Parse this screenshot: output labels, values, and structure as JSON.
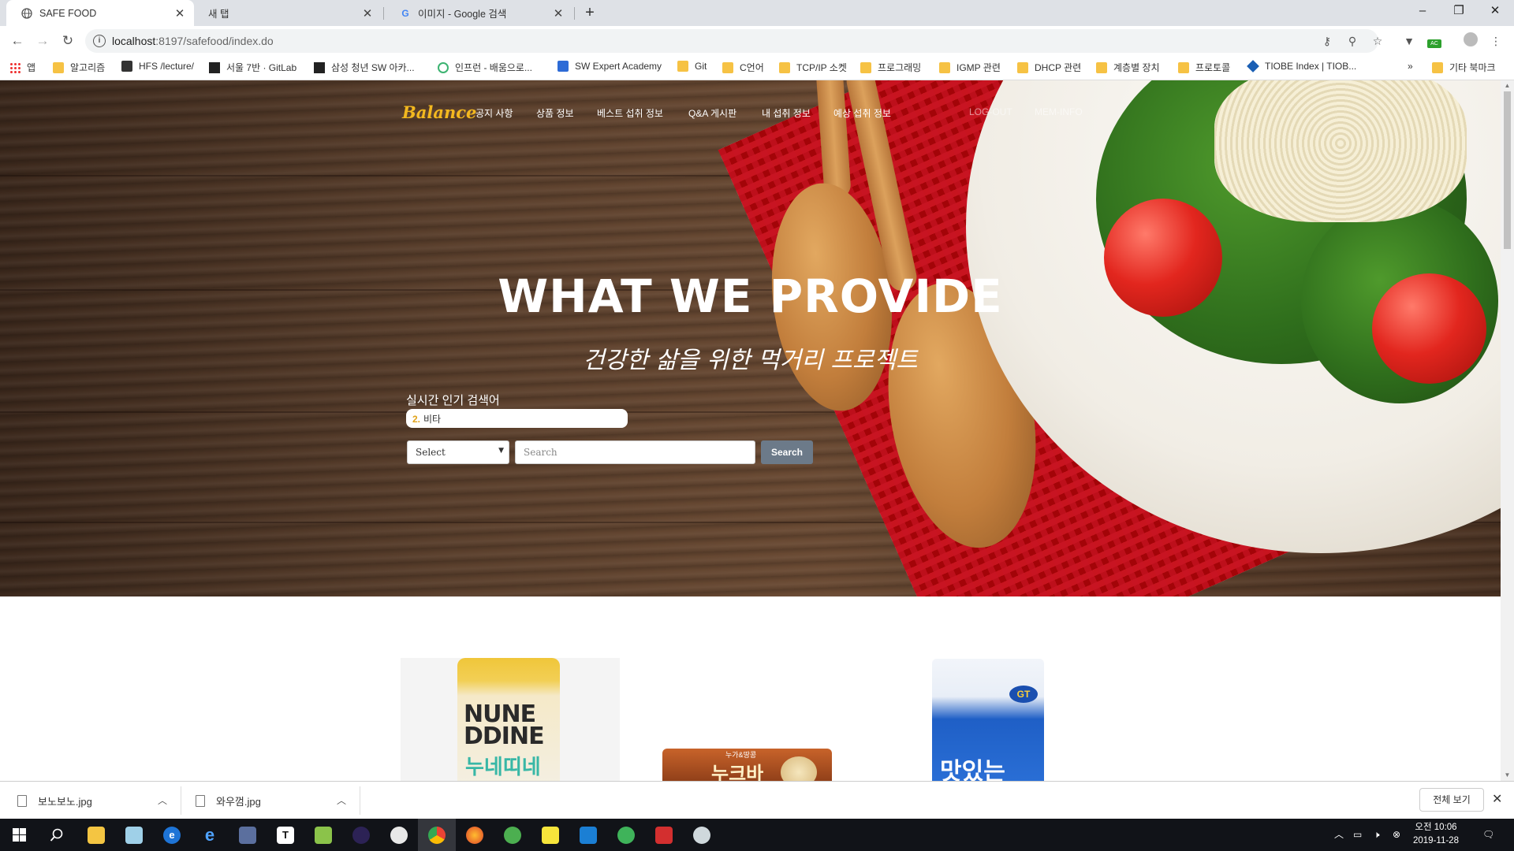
{
  "browser": {
    "tabs": [
      {
        "title": "SAFE FOOD",
        "favicon": "globe-icon",
        "active": true
      },
      {
        "title": "새 탭",
        "favicon": "",
        "active": false
      },
      {
        "title": "이미지 - Google 검색",
        "favicon": "google-icon",
        "active": false
      }
    ],
    "url_host": "localhost",
    "url_rest": ":8197/safefood/index.do",
    "bookmarks": [
      {
        "label": "앱",
        "icon": "apps-grid-icon"
      },
      {
        "label": "알고리즘",
        "icon": "folder-icon"
      },
      {
        "label": "HFS /lecture/",
        "icon": "hfs-icon"
      },
      {
        "label": "서울 7반 · GitLab",
        "icon": "gitlab-icon"
      },
      {
        "label": "삼성 청년 SW 아카...",
        "icon": "ssafy-icon"
      },
      {
        "label": "인프런 - 배움으로...",
        "icon": "inflearn-icon"
      },
      {
        "label": "SW Expert Academy",
        "icon": "swea-icon"
      },
      {
        "label": "Git",
        "icon": "folder-icon"
      },
      {
        "label": "C언어",
        "icon": "folder-icon"
      },
      {
        "label": "TCP/IP 소켓",
        "icon": "folder-icon"
      },
      {
        "label": "프로그래밍",
        "icon": "folder-icon"
      },
      {
        "label": "IGMP 관련",
        "icon": "folder-icon"
      },
      {
        "label": "DHCP 관련",
        "icon": "folder-icon"
      },
      {
        "label": "계층별 장치",
        "icon": "folder-icon"
      },
      {
        "label": "프로토콜",
        "icon": "folder-icon"
      },
      {
        "label": "TIOBE Index | TIOB...",
        "icon": "tiobe-icon"
      }
    ],
    "bookmarks_overflow": "»",
    "other_bookmarks": "기타 북마크"
  },
  "site": {
    "brand": "Balance",
    "nav": [
      {
        "label": "공지 사항"
      },
      {
        "label": "상품 정보"
      },
      {
        "label": "베스트 섭취 정보"
      },
      {
        "label": "Q&A 게시판"
      },
      {
        "label": "내 섭취 정보"
      },
      {
        "label": "예상 섭취 정보"
      },
      {
        "label": "LOG-OUT"
      },
      {
        "label": "MEM-INFO"
      }
    ],
    "hero_title": "WHAT WE PROVIDE",
    "hero_subtitle": "건강한 삶을 위한 먹거리 프로젝트",
    "hot_keywords_label": "실시간 인기 검색어",
    "hot_keyword_rank": "2.",
    "hot_keyword": "비타",
    "search": {
      "select_value": "Select",
      "placeholder": "Search",
      "button_label": "Search"
    },
    "products": [
      {
        "name": "누네띠네",
        "package_text": "NUNE DDINE",
        "label_hangul": "누네띠네"
      },
      {
        "name": "누크바",
        "package_text": "누가&땅콩",
        "label_hangul": "누크바"
      },
      {
        "name": "맛있는 우유",
        "package_text": "GT",
        "label_hangul": "맛있는"
      }
    ]
  },
  "downloads": {
    "items": [
      {
        "filename": "보노보노.jpg"
      },
      {
        "filename": "와우껌.jpg"
      }
    ],
    "show_all": "전체 보기"
  },
  "taskbar": {
    "clock_time": "오전 10:06",
    "clock_date": "2019-11-28",
    "apps": [
      "file-explorer-icon",
      "notepad-icon",
      "edge-icon",
      "internet-explorer-icon",
      "visual-studio-icon",
      "typora-icon",
      "notepad-plus-icon",
      "eclipse-icon",
      "paint-icon",
      "chrome-icon",
      "firefox-icon",
      "whale-icon",
      "sticky-notes-icon",
      "vscode-icon",
      "whale-icon",
      "acrobat-icon",
      "snipping-tool-icon"
    ]
  }
}
